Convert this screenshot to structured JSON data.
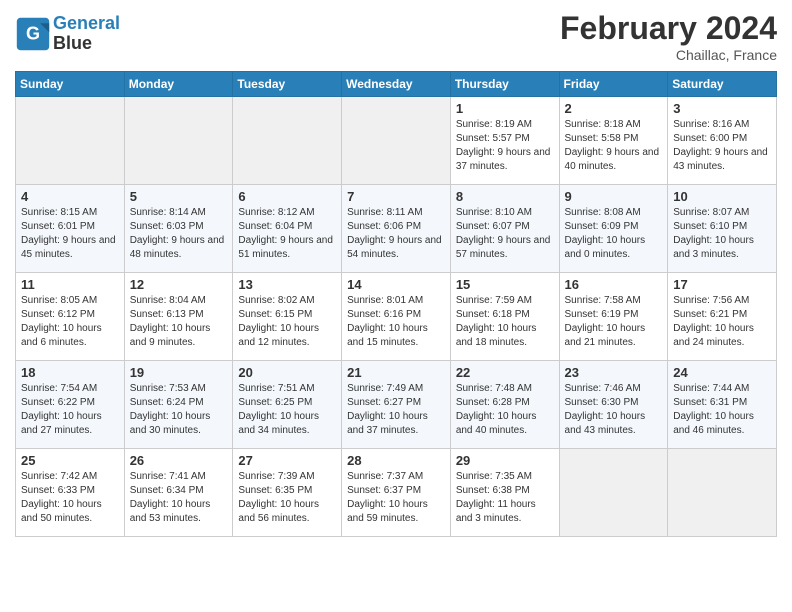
{
  "header": {
    "logo_line1": "General",
    "logo_line2": "Blue",
    "title": "February 2024",
    "subtitle": "Chaillac, France"
  },
  "days_of_week": [
    "Sunday",
    "Monday",
    "Tuesday",
    "Wednesday",
    "Thursday",
    "Friday",
    "Saturday"
  ],
  "weeks": [
    [
      {
        "day": "",
        "info": ""
      },
      {
        "day": "",
        "info": ""
      },
      {
        "day": "",
        "info": ""
      },
      {
        "day": "",
        "info": ""
      },
      {
        "day": "1",
        "info": "Sunrise: 8:19 AM\nSunset: 5:57 PM\nDaylight: 9 hours and 37 minutes."
      },
      {
        "day": "2",
        "info": "Sunrise: 8:18 AM\nSunset: 5:58 PM\nDaylight: 9 hours and 40 minutes."
      },
      {
        "day": "3",
        "info": "Sunrise: 8:16 AM\nSunset: 6:00 PM\nDaylight: 9 hours and 43 minutes."
      }
    ],
    [
      {
        "day": "4",
        "info": "Sunrise: 8:15 AM\nSunset: 6:01 PM\nDaylight: 9 hours and 45 minutes."
      },
      {
        "day": "5",
        "info": "Sunrise: 8:14 AM\nSunset: 6:03 PM\nDaylight: 9 hours and 48 minutes."
      },
      {
        "day": "6",
        "info": "Sunrise: 8:12 AM\nSunset: 6:04 PM\nDaylight: 9 hours and 51 minutes."
      },
      {
        "day": "7",
        "info": "Sunrise: 8:11 AM\nSunset: 6:06 PM\nDaylight: 9 hours and 54 minutes."
      },
      {
        "day": "8",
        "info": "Sunrise: 8:10 AM\nSunset: 6:07 PM\nDaylight: 9 hours and 57 minutes."
      },
      {
        "day": "9",
        "info": "Sunrise: 8:08 AM\nSunset: 6:09 PM\nDaylight: 10 hours and 0 minutes."
      },
      {
        "day": "10",
        "info": "Sunrise: 8:07 AM\nSunset: 6:10 PM\nDaylight: 10 hours and 3 minutes."
      }
    ],
    [
      {
        "day": "11",
        "info": "Sunrise: 8:05 AM\nSunset: 6:12 PM\nDaylight: 10 hours and 6 minutes."
      },
      {
        "day": "12",
        "info": "Sunrise: 8:04 AM\nSunset: 6:13 PM\nDaylight: 10 hours and 9 minutes."
      },
      {
        "day": "13",
        "info": "Sunrise: 8:02 AM\nSunset: 6:15 PM\nDaylight: 10 hours and 12 minutes."
      },
      {
        "day": "14",
        "info": "Sunrise: 8:01 AM\nSunset: 6:16 PM\nDaylight: 10 hours and 15 minutes."
      },
      {
        "day": "15",
        "info": "Sunrise: 7:59 AM\nSunset: 6:18 PM\nDaylight: 10 hours and 18 minutes."
      },
      {
        "day": "16",
        "info": "Sunrise: 7:58 AM\nSunset: 6:19 PM\nDaylight: 10 hours and 21 minutes."
      },
      {
        "day": "17",
        "info": "Sunrise: 7:56 AM\nSunset: 6:21 PM\nDaylight: 10 hours and 24 minutes."
      }
    ],
    [
      {
        "day": "18",
        "info": "Sunrise: 7:54 AM\nSunset: 6:22 PM\nDaylight: 10 hours and 27 minutes."
      },
      {
        "day": "19",
        "info": "Sunrise: 7:53 AM\nSunset: 6:24 PM\nDaylight: 10 hours and 30 minutes."
      },
      {
        "day": "20",
        "info": "Sunrise: 7:51 AM\nSunset: 6:25 PM\nDaylight: 10 hours and 34 minutes."
      },
      {
        "day": "21",
        "info": "Sunrise: 7:49 AM\nSunset: 6:27 PM\nDaylight: 10 hours and 37 minutes."
      },
      {
        "day": "22",
        "info": "Sunrise: 7:48 AM\nSunset: 6:28 PM\nDaylight: 10 hours and 40 minutes."
      },
      {
        "day": "23",
        "info": "Sunrise: 7:46 AM\nSunset: 6:30 PM\nDaylight: 10 hours and 43 minutes."
      },
      {
        "day": "24",
        "info": "Sunrise: 7:44 AM\nSunset: 6:31 PM\nDaylight: 10 hours and 46 minutes."
      }
    ],
    [
      {
        "day": "25",
        "info": "Sunrise: 7:42 AM\nSunset: 6:33 PM\nDaylight: 10 hours and 50 minutes."
      },
      {
        "day": "26",
        "info": "Sunrise: 7:41 AM\nSunset: 6:34 PM\nDaylight: 10 hours and 53 minutes."
      },
      {
        "day": "27",
        "info": "Sunrise: 7:39 AM\nSunset: 6:35 PM\nDaylight: 10 hours and 56 minutes."
      },
      {
        "day": "28",
        "info": "Sunrise: 7:37 AM\nSunset: 6:37 PM\nDaylight: 10 hours and 59 minutes."
      },
      {
        "day": "29",
        "info": "Sunrise: 7:35 AM\nSunset: 6:38 PM\nDaylight: 11 hours and 3 minutes."
      },
      {
        "day": "",
        "info": ""
      },
      {
        "day": "",
        "info": ""
      }
    ]
  ]
}
